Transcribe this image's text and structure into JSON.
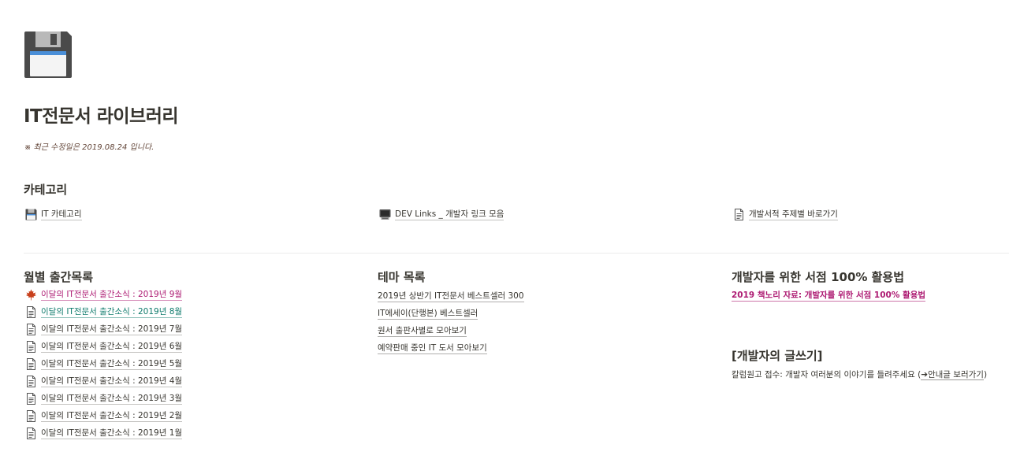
{
  "page": {
    "icon": "floppy-disk-icon",
    "title": "IT전문서 라이브러리",
    "updated": "※ 최근 수정일은 2019.08.24 입니다."
  },
  "categories": {
    "heading": "카테고리",
    "items": [
      {
        "label": "IT 카테고리",
        "icon": "floppy-disk-icon"
      },
      {
        "label": "DEV Links _ 개발자 링크 모음",
        "icon": "computer-icon"
      },
      {
        "label": "개발서적 주제별 바로가기",
        "icon": "document-icon"
      }
    ]
  },
  "monthly": {
    "heading": "월별 출간목록",
    "items": [
      {
        "label": "이달의 IT전문서 출간소식 : 2019년 9월",
        "icon": "maple-leaf-icon",
        "color": "#ad1a72"
      },
      {
        "label": "이달의 IT전문서 출간소식 : 2019년 8월",
        "icon": "document-icon",
        "color": "#0f7b6c"
      },
      {
        "label": "이달의 IT전문서 출간소식 : 2019년 7월",
        "icon": "document-icon"
      },
      {
        "label": "이달의 IT전문서 출간소식 : 2019년 6월",
        "icon": "document-icon"
      },
      {
        "label": "이달의 IT전문서 출간소식 : 2019년 5월",
        "icon": "document-icon"
      },
      {
        "label": "이달의 IT전문서 출간소식 : 2019년 4월",
        "icon": "document-icon"
      },
      {
        "label": "이달의 IT전문서 출간소식 : 2019년 3월",
        "icon": "document-icon"
      },
      {
        "label": "이달의 IT전문서 출간소식 : 2019년 2월",
        "icon": "document-icon"
      },
      {
        "label": "이달의 IT전문서 출간소식 : 2019년 1월",
        "icon": "document-icon"
      }
    ]
  },
  "themes": {
    "heading": "테마 목록",
    "items": [
      "2019년 상반기 IT전문서 베스트셀러 300",
      "IT에세이(단행본) 베스트셀러",
      "원서 출판사별로 모아보기",
      "예약판매 중인 IT 도서 모아보기"
    ]
  },
  "guide": {
    "heading": "개발자를 위한 서점 100% 활용법",
    "link": "2019 책노리 자료: 개발자를 위한 서점 100% 활용법",
    "link_color": "#ad1a72"
  },
  "writing": {
    "heading": "[개발자의 글쓰기]",
    "text": "칼럼원고 접수: 개발자 여러분의 이야기를 들려주세요 (",
    "link": "➔안내글 보러가기",
    "suffix": ")"
  }
}
